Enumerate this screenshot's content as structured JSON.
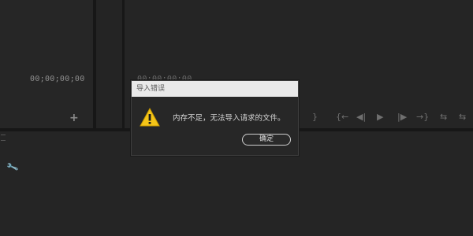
{
  "source_monitor": {
    "timecode": "00;00;00;00"
  },
  "program_monitor": {
    "timecode": "00:00:00:00",
    "controls": [
      "}",
      "{←",
      "◀|",
      "▶",
      "|▶",
      "→}",
      "⇆",
      "⇆"
    ]
  },
  "icons": {
    "add": "+",
    "wrench": "🔧",
    "warning": "warning-triangle-icon"
  },
  "dialog": {
    "title": "导入错误",
    "message": "内存不足，无法导入请求的文件。",
    "ok_label": "确定"
  },
  "colors": {
    "warning_yellow": "#f5c518",
    "dialog_title_bg": "#e9e9e9",
    "panel_bg": "#252525"
  }
}
